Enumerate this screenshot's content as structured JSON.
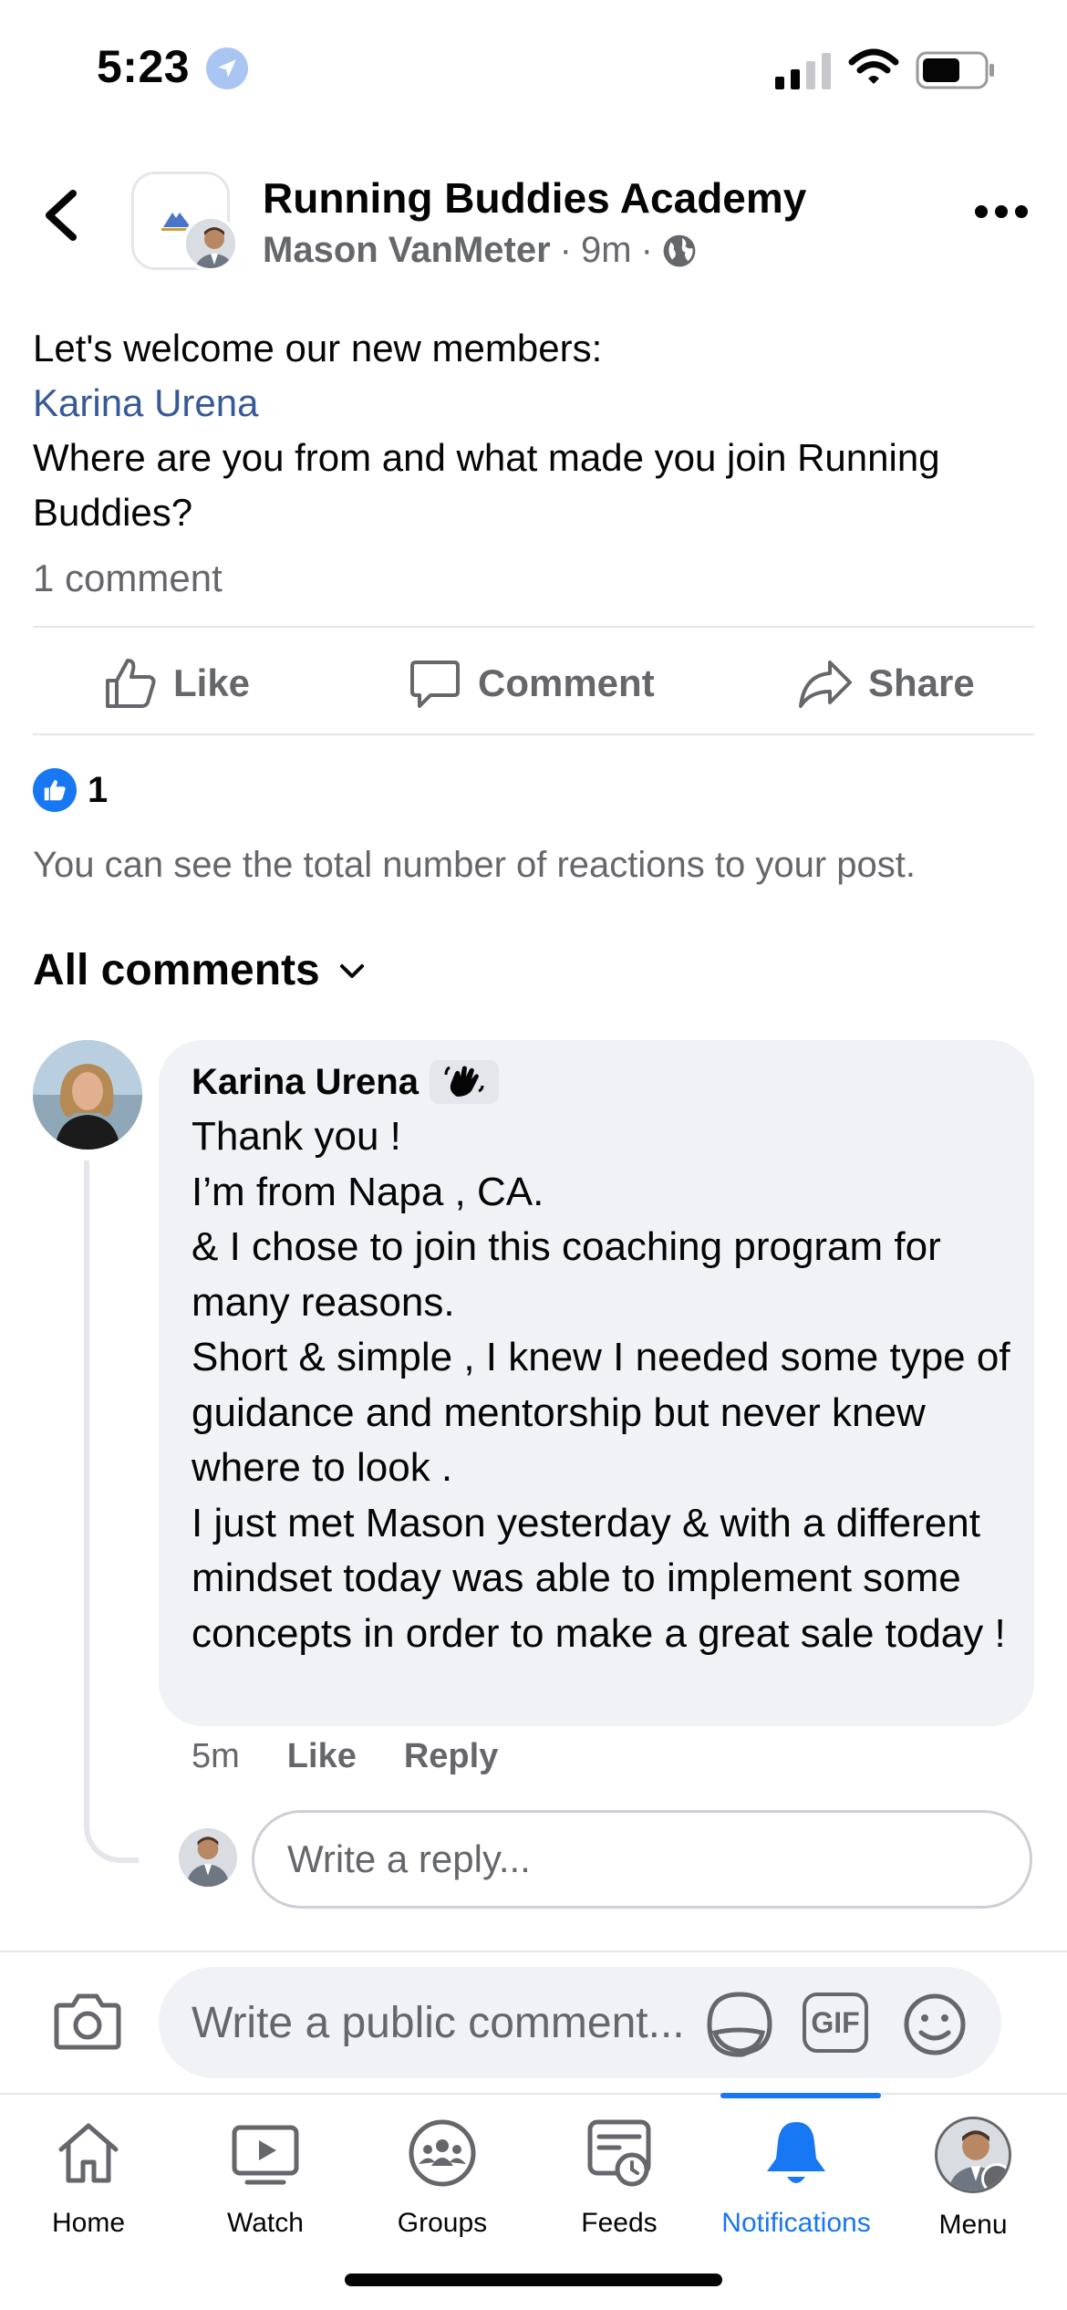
{
  "status_bar": {
    "time": "5:23"
  },
  "header": {
    "group_title": "Running Buddies Academy",
    "author": "Mason VanMeter",
    "separator": "·",
    "time": "9m",
    "privacy_icon": "globe-icon"
  },
  "post": {
    "line1": "Let's welcome our new members:",
    "mention": "Karina Urena",
    "line3": "Where are you from and what made you join Running Buddies?",
    "comment_count": "1 comment"
  },
  "actions": {
    "like": "Like",
    "comment": "Comment",
    "share": "Share"
  },
  "reactions": {
    "count": "1",
    "note": "You can see the total number of reactions to your post."
  },
  "comments_section": {
    "filter_label": "All comments"
  },
  "comment": {
    "author": "Karina Urena",
    "badge_icon": "wave-icon",
    "lines": [
      "Thank you !",
      "I’m from Napa , CA.",
      "& I chose to join this coaching program for many reasons.",
      "Short & simple , I knew I needed some type of guidance and mentorship but never knew where to look .",
      "I just met Mason yesterday & with a different mindset today was able to implement some concepts in order to make a great sale today !"
    ],
    "time": "5m",
    "like": "Like",
    "reply": "Reply"
  },
  "reply_box": {
    "placeholder": "Write a reply..."
  },
  "composer": {
    "placeholder": "Write a public comment...",
    "gif_label": "GIF"
  },
  "tabs": [
    {
      "label": "Home",
      "icon": "home-icon"
    },
    {
      "label": "Watch",
      "icon": "watch-icon"
    },
    {
      "label": "Groups",
      "icon": "groups-icon"
    },
    {
      "label": "Feeds",
      "icon": "feeds-icon"
    },
    {
      "label": "Notifications",
      "icon": "bell-icon",
      "active": true
    },
    {
      "label": "Menu",
      "icon": "menu-avatar"
    }
  ],
  "colors": {
    "accent": "#1877f2",
    "mention": "#385898",
    "muted": "#65676b",
    "bubble": "#f0f2f5"
  }
}
